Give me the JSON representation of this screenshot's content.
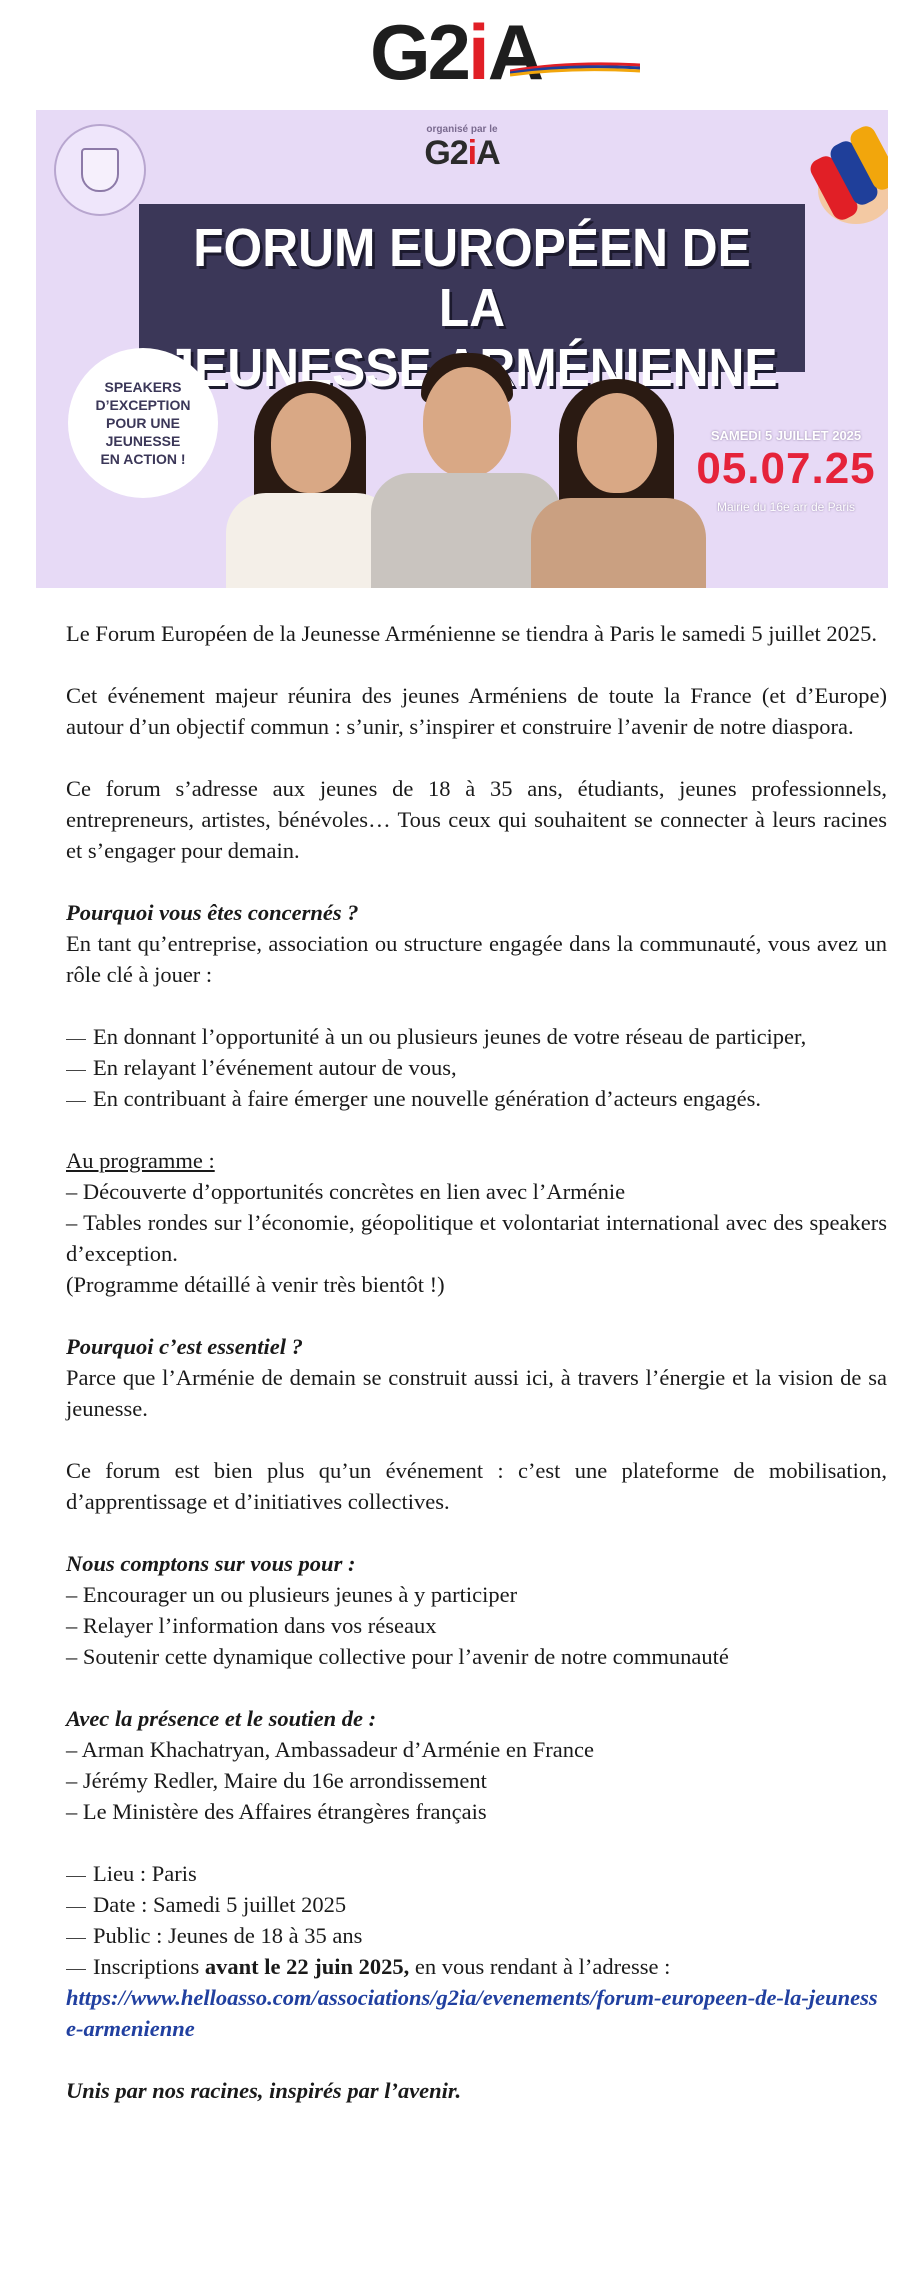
{
  "logo": {
    "g2": "G2",
    "i": "i",
    "a": "A"
  },
  "banner": {
    "organized_by": "organisé par le",
    "logo": {
      "g2": "G2",
      "i": "i",
      "a": "A"
    },
    "title_line1": "FORUM EUROPÉEN DE LA",
    "title_line2": "JEUNESSE ARMÉNIENNE",
    "speakers": [
      "SPEAKERS",
      "D’EXCEPTION",
      "POUR UNE",
      "JEUNESSE",
      "EN ACTION !"
    ],
    "date_small": "SAMEDI 5 JUILLET 2025",
    "date_big": "05.07.25",
    "venue": "Mairie du 16e arr de Paris"
  },
  "article": {
    "p1": "Le Forum Européen de la Jeunesse Arménienne se tiendra à Paris le samedi 5 juillet 2025.",
    "p2": "Cet événement majeur réunira des jeunes Arméniens de toute la France (et d’Europe) autour d’un objectif commun : s’unir, s’inspirer et construire l’avenir de notre diaspora.",
    "p3": "Ce forum s’adresse aux jeunes de 18 à 35 ans, étudiants, jeunes professionnels, entrepreneurs, artistes, bénévoles… Tous ceux qui souhaitent se connecter à leurs racines et s’engager pour demain.",
    "h_concerned": "Pourquoi vous êtes concernés ?",
    "p4": "En tant qu’entreprise, association ou structure engagée dans la communauté, vous avez un rôle clé à jouer :",
    "role_items": [
      "En donnant l’opportunité à un ou plusieurs jeunes de votre réseau de participer,",
      "En relayant l’événement autour de vous,",
      "En contribuant à faire émerger une nouvelle génération d’acteurs engagés."
    ],
    "h_program": "Au programme :",
    "program_items": [
      "– Découverte d’opportunités concrètes en lien avec l’Arménie",
      "– Tables rondes sur l’économie, géopolitique et volontariat international avec des speakers d’exception."
    ],
    "program_note": "(Programme détaillé à venir très bientôt !)",
    "h_essential": "Pourquoi c’est essentiel ?",
    "p5": "Parce que l’Arménie de demain se construit aussi ici, à travers l’énergie et la vision de sa jeunesse.",
    "p6": "Ce forum est bien plus qu’un événement : c’est une plateforme de mobilisation, d’apprentissage et d’initiatives collectives.",
    "h_count": "Nous comptons sur vous pour :",
    "count_items": [
      "– Encourager un ou plusieurs jeunes à y participer",
      "– Relayer l’information dans vos réseaux",
      "– Soutenir cette dynamique collective pour l’avenir de notre communauté"
    ],
    "h_support": "Avec la présence et le soutien de :",
    "support_items": [
      "– Arman Khachatryan, Ambassadeur d’Arménie en France",
      "– Jérémy Redler, Maire du 16e arrondissement",
      "– Le Ministère des Affaires étrangères français"
    ],
    "info_items": [
      "Lieu : Paris",
      "Date : Samedi 5 juillet 2025",
      "Public : Jeunes de 18 à 35 ans"
    ],
    "reg_prefix": "Inscriptions ",
    "reg_bold": "avant le 22 juin 2025,",
    "reg_suffix": " en vous rendant à l’adresse :",
    "link": "https://www.helloasso.com/associations/g2ia/evenements/forum-europeen-de-la-jeunesse-armenienne",
    "closing": "Unis par nos racines, inspirés par l’avenir."
  },
  "colors": {
    "brand_red": "#e11f26",
    "banner_bg": "#e7daf6",
    "title_box": "#3b3758",
    "date_red": "#e5233a",
    "link": "#2140a0"
  }
}
